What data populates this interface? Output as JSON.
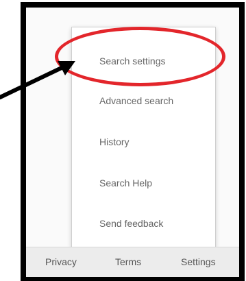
{
  "menu": {
    "items": [
      {
        "label": "Search settings"
      },
      {
        "label": "Advanced search"
      },
      {
        "label": "History"
      },
      {
        "label": "Search Help"
      },
      {
        "label": "Send feedback"
      }
    ]
  },
  "footer": {
    "privacy_label": "Privacy",
    "terms_label": "Terms",
    "settings_label": "Settings"
  },
  "annotation": {
    "highlight_color": "#e3262b",
    "arrow_color": "#000000",
    "highlighted_item": "Search settings"
  }
}
